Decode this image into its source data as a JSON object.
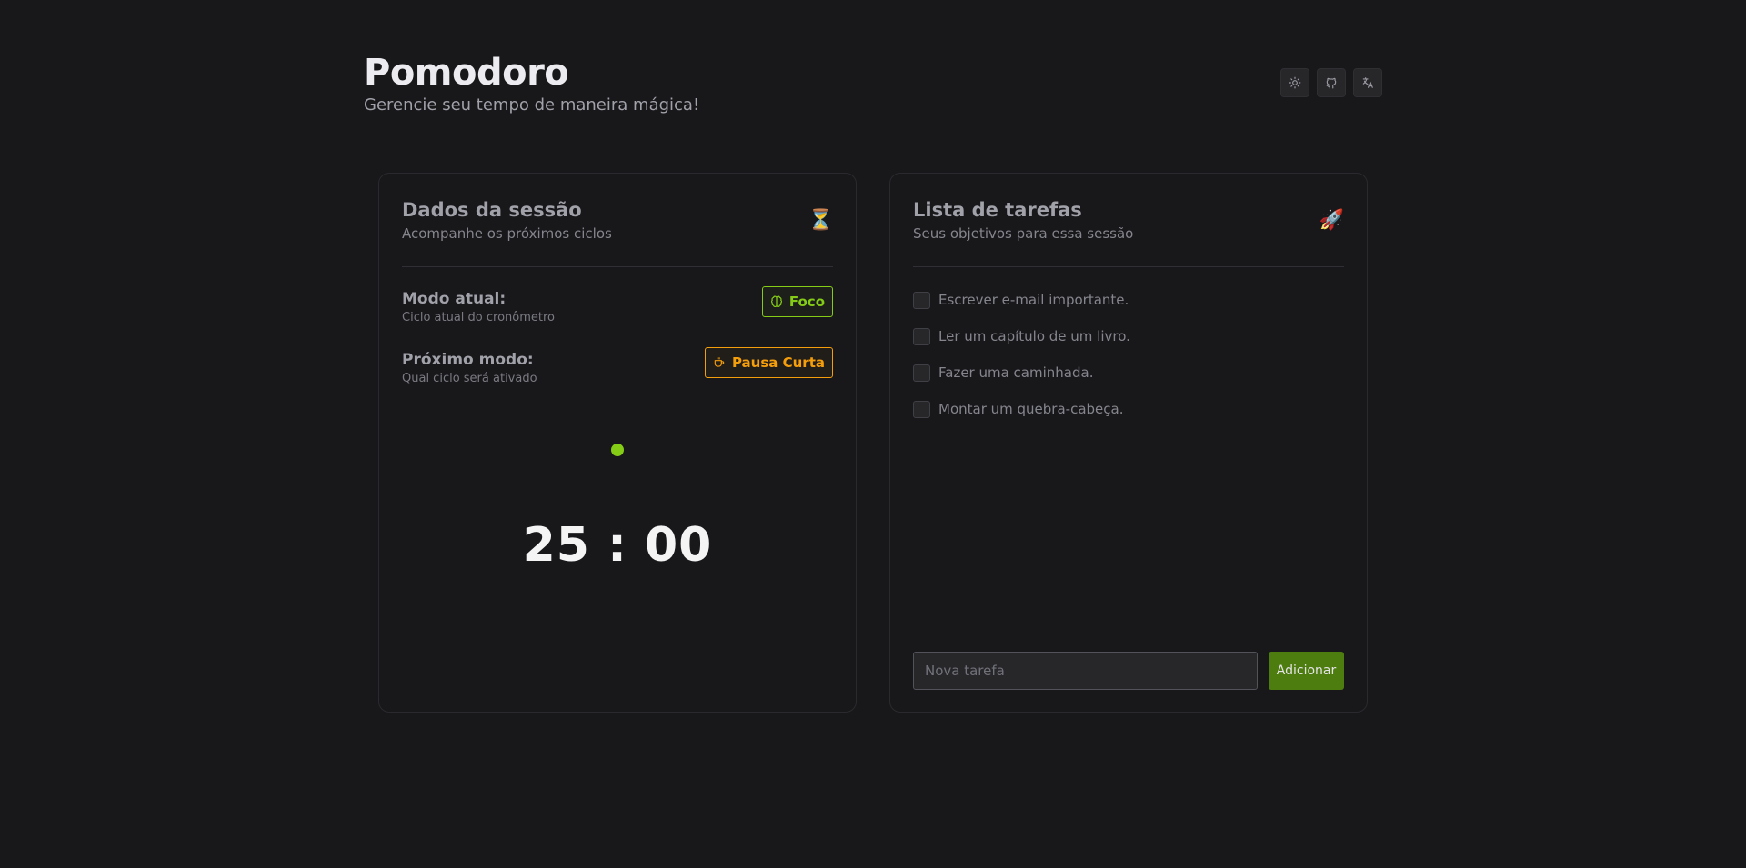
{
  "header": {
    "title": "Pomodoro",
    "subtitle": "Gerencie seu tempo de maneira mágica!",
    "buttons": [
      {
        "icon": "sun-icon"
      },
      {
        "icon": "github-icon"
      },
      {
        "icon": "translate-icon"
      }
    ]
  },
  "session": {
    "title": "Dados da sessão",
    "description": "Acompanhe os próximos ciclos",
    "emoji": "⏳",
    "current_mode": {
      "label": "Modo atual:",
      "hint": "Ciclo atual do cronômetro",
      "badge": "Foco",
      "badge_icon": "brain-icon",
      "color": "#84cc16"
    },
    "next_mode": {
      "label": "Próximo modo:",
      "hint": "Qual ciclo será ativado",
      "badge": "Pausa Curta",
      "badge_icon": "coffee-icon",
      "color": "#f59e0b"
    },
    "timer": "25 : 00"
  },
  "tasks": {
    "title": "Lista de tarefas",
    "description": "Seus objetivos para essa sessão",
    "emoji": "🚀",
    "items": [
      {
        "label": "Escrever e-mail importante.",
        "checked": false
      },
      {
        "label": "Ler um capítulo de um livro.",
        "checked": false
      },
      {
        "label": "Fazer uma caminhada.",
        "checked": false
      },
      {
        "label": "Montar um quebra-cabeça.",
        "checked": false
      }
    ],
    "input_placeholder": "Nova tarefa",
    "input_value": "",
    "add_label": "Adicionar"
  },
  "colors": {
    "background": "#18181b",
    "accent": "#84cc16",
    "warning": "#f59e0b",
    "add_button": "#4d7c0f"
  }
}
